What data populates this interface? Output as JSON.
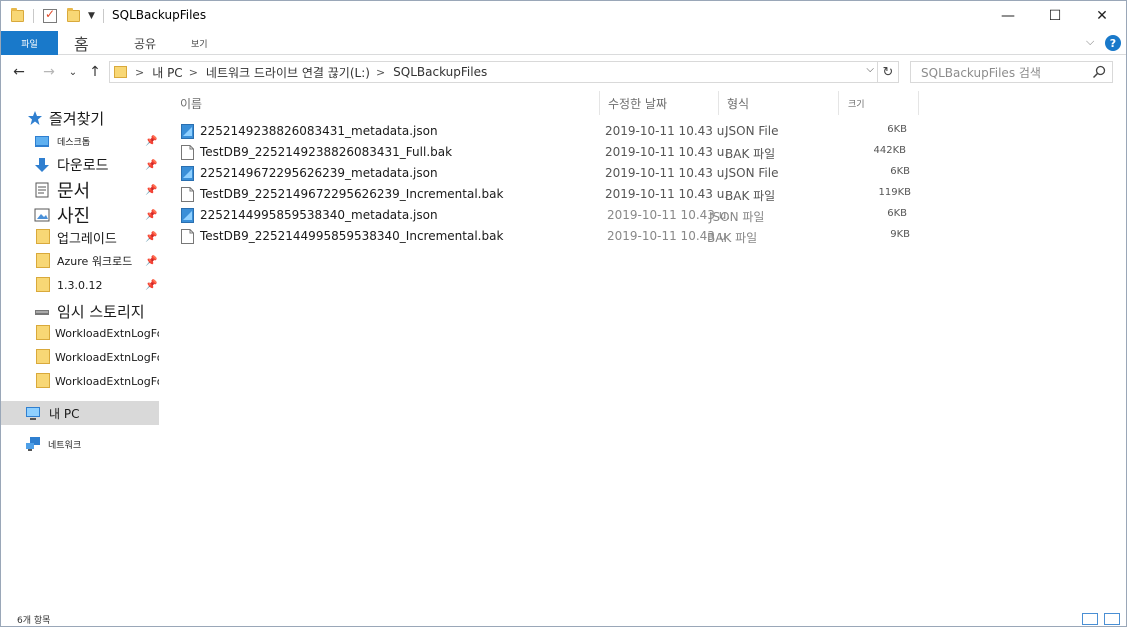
{
  "window": {
    "title": "SQLBackupFiles"
  },
  "titlebar": {
    "minimize": "—",
    "maximize": "☐",
    "close": "✕"
  },
  "ribbon": {
    "tabs": [
      {
        "label": "파일"
      },
      {
        "label": "홈"
      },
      {
        "label": "공유"
      },
      {
        "label": "보기"
      }
    ],
    "expand": "⌵",
    "help": "?"
  },
  "nav": {
    "back": "←",
    "forward": "→",
    "recent": "⌄",
    "up": "↑",
    "breadcrumbs": [
      "내 PC",
      "네트워크 드라이브 연결 끊기(L:)",
      "SQLBackupFiles"
    ],
    "crumb_sep": ">",
    "refresh": "↻",
    "search_placeholder": "SQLBackupFiles 검색"
  },
  "navpane": {
    "quick_access": "즐겨찾기",
    "items": [
      {
        "label": "데스크톱"
      },
      {
        "label": "다운로드"
      },
      {
        "label": "문서"
      },
      {
        "label": "사진"
      },
      {
        "label": "업그레이드"
      },
      {
        "label": "Azure 워크로드"
      },
      {
        "label": "1.3.0.12"
      },
      {
        "label": "임시 스토리지"
      },
      {
        "label": "WorkloadExtnLogFo"
      },
      {
        "label": "WorkloadExtnLogFo"
      },
      {
        "label": "WorkloadExtnLogFo"
      }
    ],
    "this_pc": "내 PC",
    "network": "네트워크"
  },
  "columns": {
    "name": "이름",
    "date": "수정한 날짜",
    "type": "형식",
    "size": "크기"
  },
  "files": [
    {
      "name": "2252149238826083431_metadata.json",
      "date": "2019-10-11 10.43 u.",
      "type": "JSON File",
      "size": "6KB",
      "icon": "json-file-icon"
    },
    {
      "name": "TestDB9_2252149238826083431_Full.bak",
      "date": "2019-10-11 10.43 u.",
      "type": "BAK 파일",
      "size": "442KB",
      "icon": "blank-file-icon"
    },
    {
      "name": "2252149672295626239_metadata.json",
      "date": "2019-10-11 10.43 u.",
      "type": "JSON File",
      "size": "6KB",
      "icon": "json-file-icon"
    },
    {
      "name": "TestDB9_2252149672295626239_Incremental.bak",
      "date": "2019-10-11 10.43 u.",
      "type": "BAK 파일",
      "size": "119KB",
      "icon": "blank-file-icon"
    },
    {
      "name": "2252144995859538340_metadata.json",
      "date": "2019-10-11 10.43 u.",
      "type": "JSON 파일",
      "size": "6KB",
      "icon": "json-file-icon"
    },
    {
      "name": "TestDB9_2252144995859538340_Incremental.bak",
      "date": "2019-10-11 10.43 u.",
      "type": "BAK 파일",
      "size": "9KB",
      "icon": "blank-file-icon"
    }
  ],
  "status": {
    "item_count": "6개 항목"
  },
  "colors": {
    "accent": "#1979ca",
    "folder": "#f8d775",
    "selection": "#d9d9d9"
  }
}
